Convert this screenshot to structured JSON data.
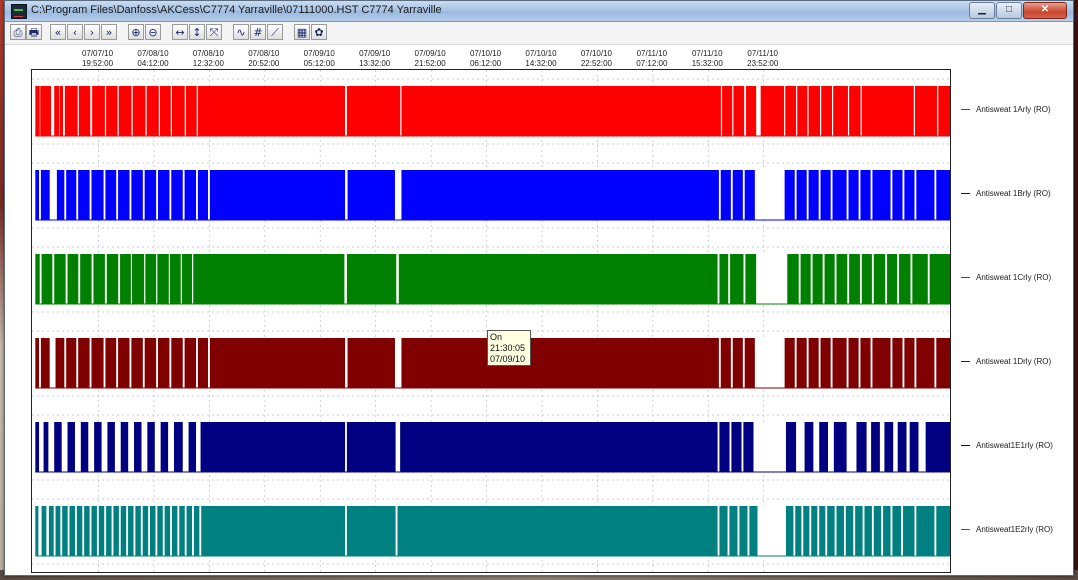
{
  "window": {
    "title": "C:\\Program Files\\Danfoss\\AKCess\\C7774 Yarraville\\07111000.HST  C7774 Yarraville",
    "buttons": [
      "minimize",
      "maximize",
      "close"
    ]
  },
  "toolbar": {
    "buttons": [
      {
        "name": "print-preview-icon",
        "glyph": "⎙"
      },
      {
        "name": "print-icon",
        "glyph": "🖶"
      },
      {
        "name": "scroll-first-icon",
        "glyph": "«"
      },
      {
        "name": "scroll-prev-icon",
        "glyph": "‹"
      },
      {
        "name": "scroll-next-icon",
        "glyph": "›"
      },
      {
        "name": "scroll-last-icon",
        "glyph": "»"
      },
      {
        "name": "zoom-in-icon",
        "glyph": "⊕"
      },
      {
        "name": "zoom-out-icon",
        "glyph": "⊖"
      },
      {
        "name": "fit-horizontal-icon",
        "glyph": "↔"
      },
      {
        "name": "fit-vertical-icon",
        "glyph": "↕"
      },
      {
        "name": "fit-all-icon",
        "glyph": "⤧"
      },
      {
        "name": "curve-style-icon",
        "glyph": "∿"
      },
      {
        "name": "grid-toggle-icon",
        "glyph": "#"
      },
      {
        "name": "axis-scale-icon",
        "glyph": "⟋"
      },
      {
        "name": "table-view-icon",
        "glyph": "▦"
      },
      {
        "name": "settings-icon",
        "glyph": "✿"
      }
    ]
  },
  "chart_data": {
    "type": "digital-state-timeline",
    "tick_labels": [
      {
        "date": "07/07/10",
        "time": "19:52:00"
      },
      {
        "date": "07/08/10",
        "time": "04:12:00"
      },
      {
        "date": "07/08/10",
        "time": "12:32:00"
      },
      {
        "date": "07/08/10",
        "time": "20:52:00"
      },
      {
        "date": "07/09/10",
        "time": "05:12:00"
      },
      {
        "date": "07/09/10",
        "time": "13:32:00"
      },
      {
        "date": "07/09/10",
        "time": "21:52:00"
      },
      {
        "date": "07/10/10",
        "time": "06:12:00"
      },
      {
        "date": "07/10/10",
        "time": "14:32:00"
      },
      {
        "date": "07/10/10",
        "time": "22:52:00"
      },
      {
        "date": "07/11/10",
        "time": "07:12:00"
      },
      {
        "date": "07/11/10",
        "time": "15:32:00"
      },
      {
        "date": "07/11/10",
        "time": "23:52:00"
      }
    ],
    "x_unit": "hours since 07/07/10 19:52:00",
    "x_range": [
      -10,
      128
    ],
    "grid": true,
    "legend_position": "right",
    "series": [
      {
        "name": "Antisweat 1Arly (RO)",
        "color": "#ff0000",
        "off_gaps": [
          [
            -8.9,
            -8.7
          ],
          [
            -7.2,
            -6.6
          ],
          [
            -5.4,
            -5.0
          ],
          [
            -3.2,
            -2.9
          ],
          [
            -1.3,
            -0.9
          ],
          [
            0.9,
            1.2
          ],
          [
            2.8,
            3.1
          ],
          [
            4.9,
            5.2
          ],
          [
            7.0,
            7.3
          ],
          [
            9.0,
            9.3
          ],
          [
            10.8,
            11.1
          ],
          [
            12.9,
            13.2
          ],
          [
            14.7,
            15.0
          ],
          [
            37.0,
            37.4
          ],
          [
            45.3,
            45.6
          ],
          [
            93.5,
            93.8
          ],
          [
            95.2,
            95.5
          ],
          [
            97.0,
            97.4
          ],
          [
            98.8,
            99.6
          ],
          [
            103.0,
            103.3
          ],
          [
            104.8,
            105.1
          ],
          [
            106.5,
            106.8
          ],
          [
            108.4,
            108.7
          ],
          [
            110.2,
            110.5
          ],
          [
            112.6,
            112.9
          ],
          [
            122.5,
            122.8
          ],
          [
            126.0,
            126.3
          ],
          [
            -6.0,
            -5.8
          ],
          [
            114.5,
            114.8
          ]
        ]
      },
      {
        "name": "Antisweat 1Brly (RO)",
        "color": "#0000ff",
        "off_gaps": [
          [
            -9.0,
            -8.6
          ],
          [
            -7.4,
            -6.2
          ],
          [
            -5.2,
            -4.8
          ],
          [
            -3.4,
            -3.0
          ],
          [
            -1.4,
            -1.0
          ],
          [
            0.7,
            1.1
          ],
          [
            2.6,
            3.0
          ],
          [
            4.6,
            5.0
          ],
          [
            6.6,
            7.0
          ],
          [
            8.6,
            9.0
          ],
          [
            10.6,
            11.0
          ],
          [
            12.6,
            13.0
          ],
          [
            14.6,
            15.0
          ],
          [
            16.4,
            16.8
          ],
          [
            37.0,
            37.5
          ],
          [
            44.5,
            45.6
          ],
          [
            93.2,
            93.6
          ],
          [
            95.0,
            95.4
          ],
          [
            96.8,
            97.2
          ],
          [
            98.6,
            103.2
          ],
          [
            104.6,
            105.0
          ],
          [
            106.4,
            106.8
          ],
          [
            108.2,
            108.6
          ],
          [
            110.0,
            110.4
          ],
          [
            112.4,
            112.8
          ],
          [
            114.2,
            114.6
          ],
          [
            116.0,
            116.4
          ],
          [
            119.0,
            119.4
          ],
          [
            120.8,
            121.2
          ],
          [
            122.6,
            123.0
          ],
          [
            125.6,
            126.0
          ]
        ]
      },
      {
        "name": "Antisweat 1Crly (RO)",
        "color": "#008000",
        "off_gaps": [
          [
            -8.9,
            -8.5
          ],
          [
            -7.0,
            -6.6
          ],
          [
            -5.0,
            -4.6
          ],
          [
            -3.1,
            -2.7
          ],
          [
            -1.1,
            -0.7
          ],
          [
            0.9,
            1.3
          ],
          [
            2.9,
            3.3
          ],
          [
            4.8,
            5.1
          ],
          [
            6.8,
            7.1
          ],
          [
            8.6,
            8.9
          ],
          [
            10.5,
            10.8
          ],
          [
            12.3,
            12.6
          ],
          [
            14.0,
            14.3
          ],
          [
            36.9,
            37.4
          ],
          [
            44.7,
            45.2
          ],
          [
            93.0,
            93.4
          ],
          [
            94.6,
            95.0
          ],
          [
            96.9,
            97.3
          ],
          [
            98.8,
            103.6
          ],
          [
            105.2,
            105.6
          ],
          [
            107.0,
            107.4
          ],
          [
            108.8,
            109.2
          ],
          [
            110.6,
            111.0
          ],
          [
            112.5,
            112.9
          ],
          [
            114.4,
            114.8
          ],
          [
            116.2,
            116.6
          ],
          [
            118.2,
            118.6
          ],
          [
            120.0,
            120.4
          ],
          [
            122.0,
            122.4
          ],
          [
            124.6,
            125.0
          ]
        ]
      },
      {
        "name": "Antisweat 1Drly (RO)",
        "color": "#800000",
        "off_gaps": [
          [
            -9.0,
            -8.6
          ],
          [
            -7.4,
            -6.4
          ],
          [
            -5.2,
            -4.8
          ],
          [
            -3.4,
            -3.0
          ],
          [
            -1.4,
            -1.0
          ],
          [
            0.7,
            1.1
          ],
          [
            2.6,
            3.0
          ],
          [
            4.6,
            5.0
          ],
          [
            6.6,
            7.0
          ],
          [
            8.6,
            9.0
          ],
          [
            10.6,
            11.0
          ],
          [
            12.6,
            13.0
          ],
          [
            14.6,
            15.0
          ],
          [
            16.4,
            16.8
          ],
          [
            37.0,
            37.5
          ],
          [
            44.5,
            45.6
          ],
          [
            93.2,
            93.6
          ],
          [
            95.0,
            95.4
          ],
          [
            96.8,
            97.2
          ],
          [
            98.6,
            103.2
          ],
          [
            104.6,
            105.0
          ],
          [
            106.4,
            106.8
          ],
          [
            108.2,
            108.6
          ],
          [
            110.0,
            110.4
          ],
          [
            112.4,
            112.8
          ],
          [
            114.2,
            114.6
          ],
          [
            116.0,
            116.4
          ],
          [
            119.0,
            119.4
          ],
          [
            120.8,
            121.2
          ],
          [
            122.6,
            123.0
          ],
          [
            125.6,
            126.0
          ]
        ]
      },
      {
        "name": "Antisweat1E1rly (RO)",
        "color": "#000080",
        "off_gaps": [
          [
            -9.0,
            -8.2
          ],
          [
            -7.6,
            -6.6
          ],
          [
            -5.6,
            -4.6
          ],
          [
            -3.6,
            -2.6
          ],
          [
            -1.6,
            -0.6
          ],
          [
            0.4,
            1.4
          ],
          [
            2.4,
            3.4
          ],
          [
            4.4,
            5.4
          ],
          [
            6.4,
            7.4
          ],
          [
            8.4,
            9.4
          ],
          [
            10.4,
            11.4
          ],
          [
            12.6,
            13.6
          ],
          [
            14.6,
            15.4
          ],
          [
            37.0,
            37.4
          ],
          [
            44.6,
            45.4
          ],
          [
            93.0,
            93.4
          ],
          [
            94.8,
            95.2
          ],
          [
            96.6,
            97.0
          ],
          [
            98.4,
            103.4
          ],
          [
            104.8,
            106.2
          ],
          [
            107.4,
            108.4
          ],
          [
            109.6,
            110.6
          ],
          [
            112.4,
            114.0
          ],
          [
            115.4,
            116.2
          ],
          [
            117.4,
            118.2
          ],
          [
            119.4,
            120.2
          ],
          [
            121.4,
            122.0
          ],
          [
            123.2,
            124.4
          ]
        ]
      },
      {
        "name": "Antisweat1E2rly (RO)",
        "color": "#008080",
        "off_gaps": [
          [
            -9.1,
            -8.5
          ],
          [
            -7.9,
            -7.4
          ],
          [
            -6.8,
            -6.4
          ],
          [
            -5.8,
            -5.4
          ],
          [
            -4.7,
            -4.3
          ],
          [
            -3.6,
            -3.2
          ],
          [
            -2.5,
            -2.1
          ],
          [
            -1.4,
            -1.0
          ],
          [
            -0.3,
            0.1
          ],
          [
            0.8,
            1.2
          ],
          [
            1.9,
            2.3
          ],
          [
            3.0,
            3.4
          ],
          [
            4.1,
            4.5
          ],
          [
            5.2,
            5.6
          ],
          [
            6.3,
            6.7
          ],
          [
            7.4,
            7.8
          ],
          [
            8.5,
            8.9
          ],
          [
            9.6,
            10.0
          ],
          [
            10.7,
            11.1
          ],
          [
            11.8,
            12.2
          ],
          [
            12.9,
            13.3
          ],
          [
            14.0,
            14.4
          ],
          [
            15.1,
            15.5
          ],
          [
            37.0,
            37.4
          ],
          [
            44.6,
            45.0
          ],
          [
            93.0,
            93.4
          ],
          [
            94.5,
            94.9
          ],
          [
            96.0,
            96.4
          ],
          [
            97.5,
            97.9
          ],
          [
            99.0,
            103.4
          ],
          [
            104.4,
            104.8
          ],
          [
            105.6,
            106.0
          ],
          [
            106.8,
            107.2
          ],
          [
            108.0,
            108.4
          ],
          [
            109.2,
            109.6
          ],
          [
            110.6,
            111.0
          ],
          [
            112.0,
            112.4
          ],
          [
            113.4,
            113.8
          ],
          [
            114.8,
            115.2
          ],
          [
            116.2,
            116.6
          ],
          [
            117.6,
            118.0
          ],
          [
            119.0,
            119.4
          ],
          [
            120.6,
            121.0
          ],
          [
            122.6,
            123.0
          ],
          [
            125.6,
            126.0
          ]
        ]
      }
    ]
  },
  "tooltip": {
    "state": "On",
    "time": "21:30:05",
    "date": "07/09/10"
  }
}
